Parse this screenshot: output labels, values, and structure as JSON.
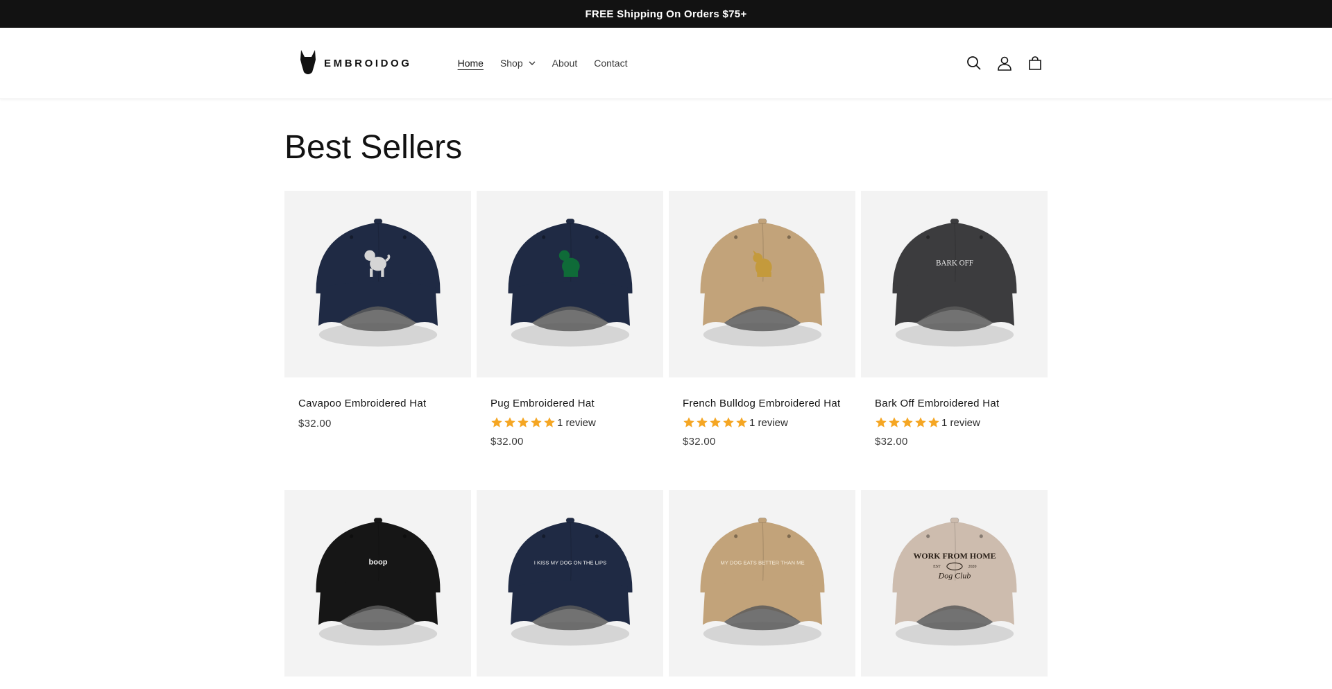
{
  "announcement": "FREE Shipping On Orders $75+",
  "brand": {
    "name": "EMBROIDOG"
  },
  "nav": {
    "items": [
      {
        "label": "Home",
        "active": true
      },
      {
        "label": "Shop",
        "dropdown": true
      },
      {
        "label": "About"
      },
      {
        "label": "Contact"
      }
    ]
  },
  "header_icons": [
    "search-icon",
    "account-icon",
    "cart-icon"
  ],
  "section": {
    "title": "Best Sellers"
  },
  "colors": {
    "star": "#f5a623",
    "announcement_bg": "#121212",
    "card_bg": "#f3f3f3"
  },
  "products": [
    {
      "title": "Cavapoo Embroidered Hat",
      "price": "$32.00",
      "stars": null,
      "reviews": null,
      "hat_color": "#1f2a44",
      "design": "cavapoo",
      "design_color": "#d5d5d5"
    },
    {
      "title": "Pug Embroidered Hat",
      "price": "$32.00",
      "stars": 5,
      "reviews": "1 review",
      "hat_color": "#1f2a44",
      "design": "pug",
      "design_color": "#0f6b38"
    },
    {
      "title": "French Bulldog Embroidered Hat",
      "price": "$32.00",
      "stars": 5,
      "reviews": "1 review",
      "hat_color": "#c2a37a",
      "design": "frenchie",
      "design_color": "#c49a3c"
    },
    {
      "title": "Bark Off Embroidered Hat",
      "price": "$32.00",
      "stars": 5,
      "reviews": "1 review",
      "hat_color": "#3c3c3e",
      "design_text": "BARK OFF",
      "design_color": "#e8e8e8"
    },
    {
      "hat_color": "#161616",
      "design_text": "boop",
      "design_color": "#f0f0f0"
    },
    {
      "hat_color": "#1f2a44",
      "design_text": "I KISS MY DOG ON THE LIPS",
      "design_color": "#f0f0f0"
    },
    {
      "hat_color": "#c2a37a",
      "design_text": "MY DOG EATS BETTER THAN ME",
      "design_color": "#f4ead8"
    },
    {
      "hat_color": "#cdbcae",
      "design_text": "WORK FROM HOME",
      "design_text2": "Dog Club",
      "design_text3": "EST",
      "design_text4": "2020",
      "design_color": "#2a2018"
    }
  ]
}
